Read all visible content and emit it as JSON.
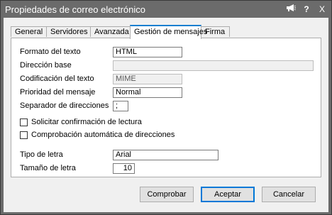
{
  "window": {
    "title": "Propiedades de correo electrónico",
    "title_icons": [
      "megaphone-icon",
      "help-icon",
      "close-icon"
    ],
    "help_glyph": "?",
    "close_glyph": "X"
  },
  "tabs": [
    {
      "label": "General",
      "active": false
    },
    {
      "label": "Servidores",
      "active": false
    },
    {
      "label": "Avanzada",
      "active": false
    },
    {
      "label": "Gestión de mensajes",
      "active": true
    },
    {
      "label": "Firma",
      "active": false
    }
  ],
  "form": {
    "formato": {
      "label": "Formato del texto",
      "value": "HTML"
    },
    "direccion": {
      "label": "Dirección base",
      "value": ""
    },
    "codificacion": {
      "label": "Codificación del texto",
      "value": "MIME"
    },
    "prioridad": {
      "label": "Prioridad del mensaje",
      "value": "Normal"
    },
    "separador": {
      "label": "Separador de direcciones",
      "value": ";"
    },
    "confirmacion": {
      "label": "Solicitar confirmación de lectura",
      "checked": false
    },
    "comprobacion": {
      "label": "Comprobación automática de direcciones",
      "checked": false
    },
    "tipo_letra": {
      "label": "Tipo de letra",
      "value": "Arial"
    },
    "tamano_letra": {
      "label": "Tamaño de letra",
      "value": "10"
    }
  },
  "buttons": {
    "comprobar": "Comprobar",
    "aceptar": "Aceptar",
    "cancelar": "Cancelar"
  },
  "colors": {
    "titlebar": "#6b6b6b",
    "active_tab_accent": "#1a7fd0",
    "default_button_border": "#0078d7"
  }
}
